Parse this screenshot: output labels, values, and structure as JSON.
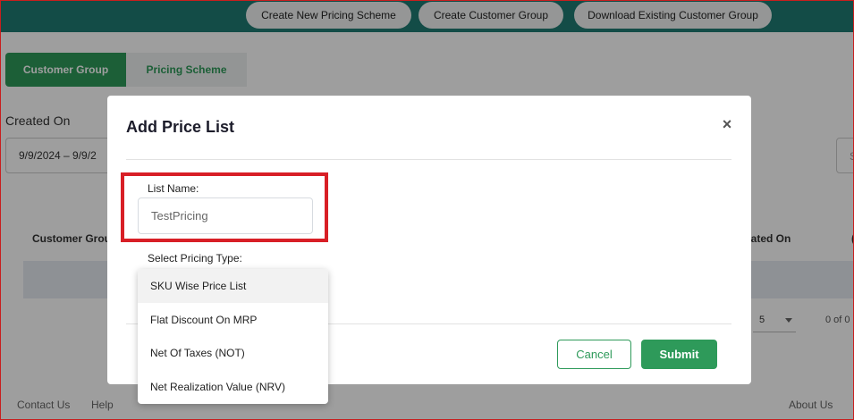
{
  "topbar": {
    "buttons": [
      "Create New Pricing Scheme",
      "Create Customer Group",
      "Download Existing Customer Group"
    ]
  },
  "tabs": [
    {
      "label": "Customer Group",
      "active": true
    },
    {
      "label": "Pricing Scheme",
      "active": false
    }
  ],
  "filters": {
    "created_on_label": "Created On",
    "date_range_value": "9/9/2024 – 9/9/2",
    "right_input_text": "S"
  },
  "table": {
    "header_customer_group": "Customer Grou",
    "header_updated_on": "pdated On",
    "header_stub": "(",
    "page_size": "5",
    "page_count": "0 of 0"
  },
  "footer": {
    "contact": "Contact Us",
    "help": "Help",
    "about": "About Us"
  },
  "modal": {
    "title": "Add Price List",
    "close_symbol": "×",
    "list_name_label": "List Name:",
    "list_name_value": "TestPricing",
    "pricing_type_label": "Select Pricing Type:",
    "cancel_label": "Cancel",
    "submit_label": "Submit"
  },
  "dropdown": {
    "options": [
      "SKU Wise Price List",
      "Flat Discount On MRP",
      "Net Of Taxes (NOT)",
      "Net Realization Value (NRV)"
    ],
    "highlighted_index": 0
  },
  "colors": {
    "primary_green": "#2e9a5a",
    "topbar_teal": "#1f7b73",
    "highlight_red": "#d81f26"
  }
}
